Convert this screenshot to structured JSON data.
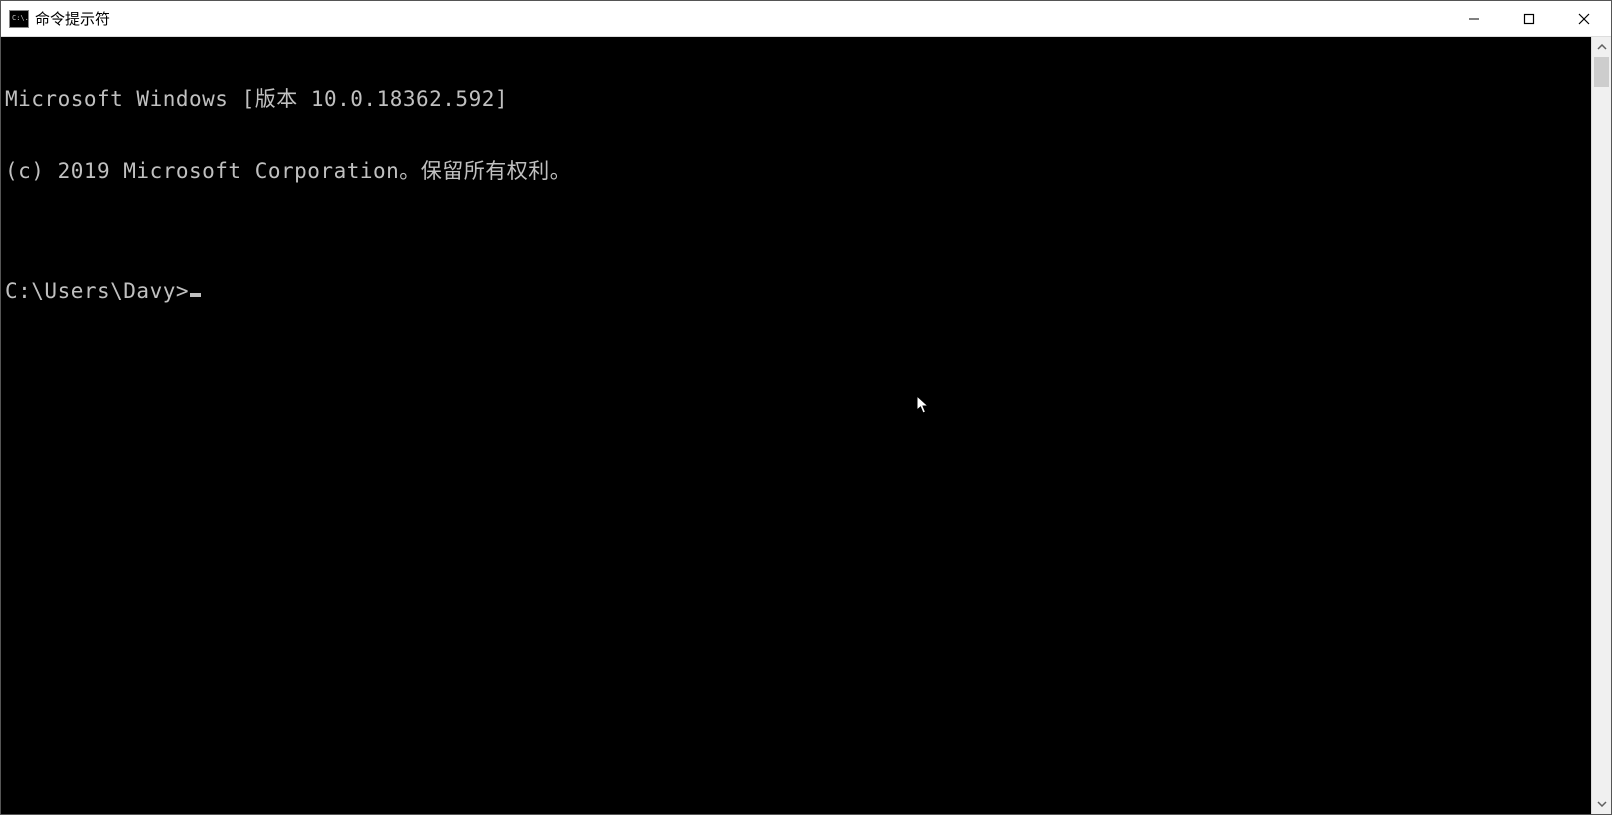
{
  "window": {
    "title": "命令提示符",
    "icon_glyph": "C:\\."
  },
  "terminal": {
    "line1": "Microsoft Windows [版本 10.0.18362.592]",
    "line2": "(c) 2019 Microsoft Corporation。保留所有权利。",
    "blank": "",
    "prompt": "C:\\Users\\Davy>"
  },
  "colors": {
    "terminal_bg": "#000000",
    "terminal_fg": "#c0c0c0",
    "titlebar_bg": "#ffffff"
  }
}
